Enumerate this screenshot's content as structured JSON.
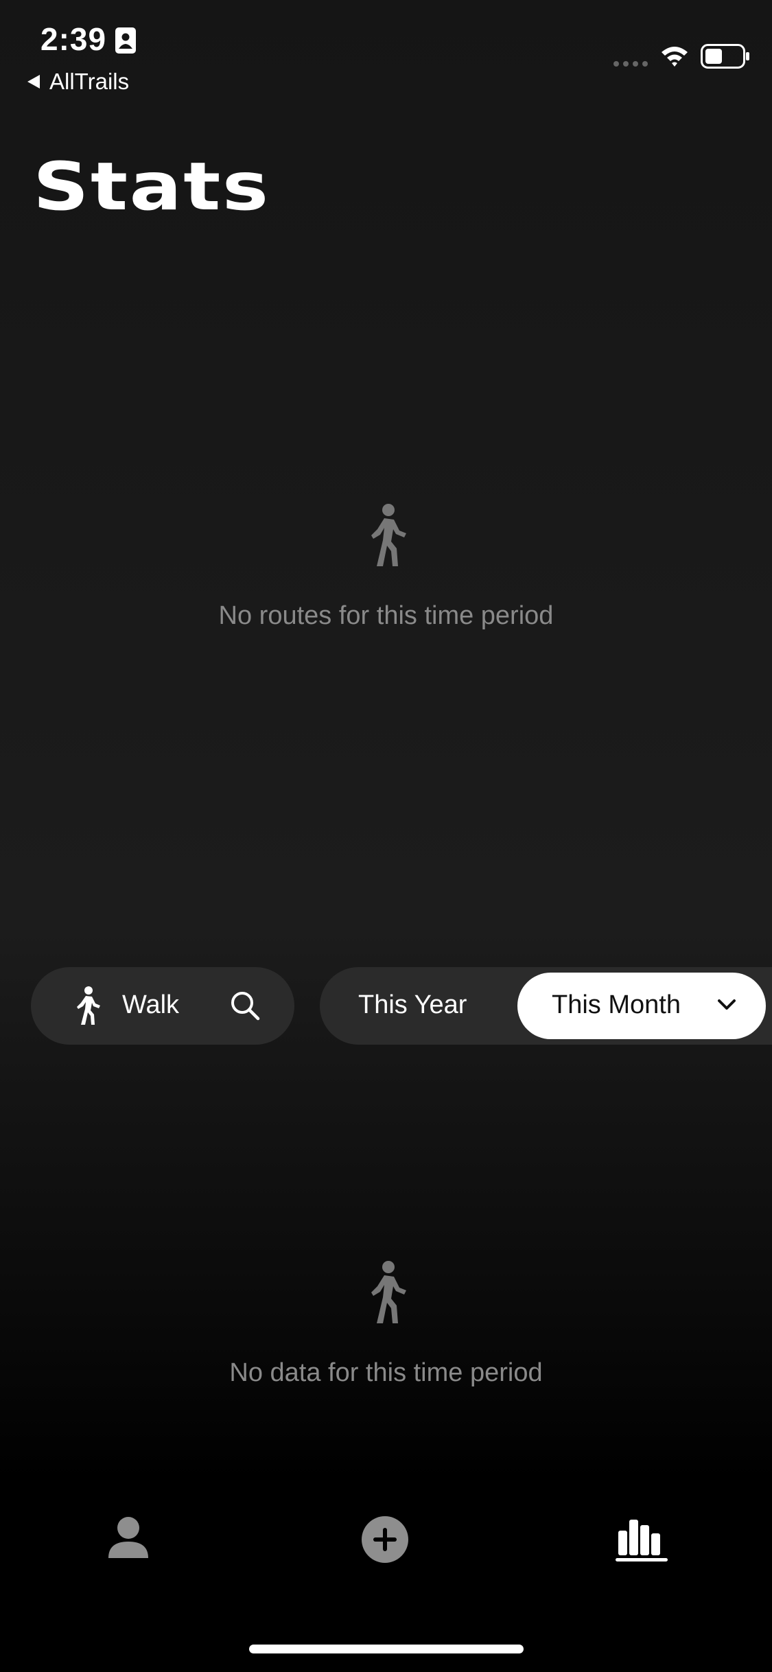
{
  "status_bar": {
    "time": "2:39",
    "back_label": "AllTrails"
  },
  "header": {
    "title": "Stats"
  },
  "routes_empty": {
    "message": "No routes for this time period",
    "icon": "walking-person-icon"
  },
  "filters": {
    "activity_label": "Walk",
    "activity_icon": "walking-person-icon",
    "search_icon": "search-icon",
    "period_options": [
      "This Year",
      "This Month"
    ],
    "selected_period": "This Month"
  },
  "data_empty": {
    "message": "No data for this time period",
    "icon": "walking-person-icon"
  },
  "tab_bar": {
    "tabs": [
      "profile-icon",
      "add-icon",
      "stats-icon"
    ],
    "active": "stats-icon"
  },
  "colors": {
    "background": "#1c1c1c",
    "pill_background": "#2b2b2b",
    "muted_text": "#8a8a8a",
    "selected_pill": "#ffffff"
  }
}
